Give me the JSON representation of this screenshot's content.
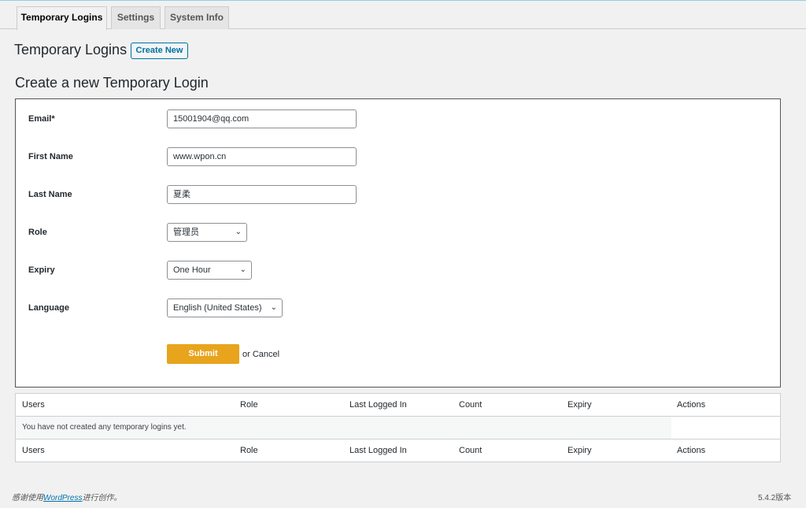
{
  "tabs": [
    {
      "label": "Temporary Logins",
      "active": true
    },
    {
      "label": "Settings",
      "active": false
    },
    {
      "label": "System Info",
      "active": false
    }
  ],
  "page_title": "Temporary Logins",
  "create_new_label": "Create New",
  "section_title": "Create a new Temporary Login",
  "form": {
    "email": {
      "label": "Email*",
      "value": "15001904@qq.com"
    },
    "first_name": {
      "label": "First Name",
      "value": "www.wpon.cn"
    },
    "last_name": {
      "label": "Last Name",
      "value": "夏柔"
    },
    "role": {
      "label": "Role",
      "value": "管理员"
    },
    "expiry": {
      "label": "Expiry",
      "value": "One Hour"
    },
    "language": {
      "label": "Language",
      "value": "English (United States)"
    },
    "submit_label": "Submit",
    "or_text": "or",
    "cancel_label": "Cancel"
  },
  "table": {
    "columns": [
      "Users",
      "Role",
      "Last Logged In",
      "Count",
      "Expiry",
      "Actions"
    ],
    "empty_message": "You have not created any temporary logins yet."
  },
  "footer": {
    "thanks_prefix": "感谢使用",
    "thanks_link": "WordPress",
    "thanks_suffix": "进行创作。",
    "version": "5.4.2版本"
  },
  "colors": {
    "submit_bg": "#e8a41d",
    "link": "#0073aa",
    "button_border": "#0071a1"
  }
}
